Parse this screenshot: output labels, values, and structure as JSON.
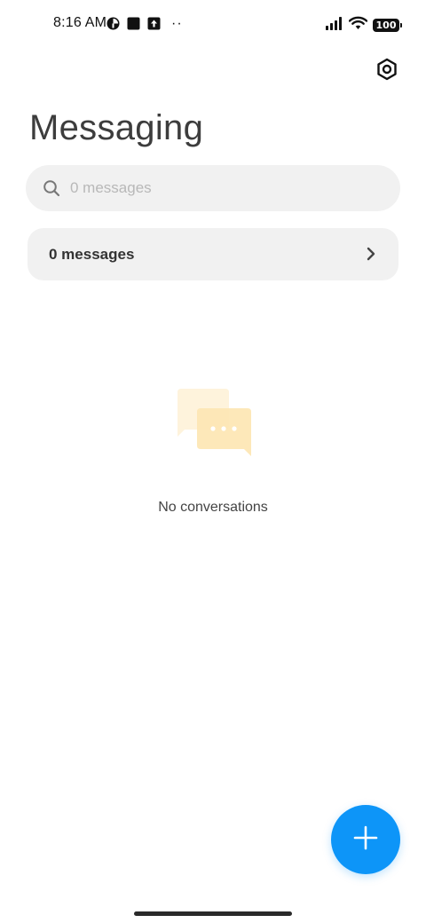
{
  "status_bar": {
    "time": "8:16 AM",
    "left_icons": [
      "app-notification-icon",
      "square-notification-icon",
      "upload-notification-icon"
    ],
    "more_dots": "··",
    "battery": "100",
    "right_icons": [
      "signal-icon",
      "wifi-icon",
      "battery-icon"
    ]
  },
  "header": {
    "title": "Messaging",
    "settings_icon": "settings-icon"
  },
  "search": {
    "placeholder": "0 messages",
    "value": ""
  },
  "messages_row": {
    "label": "0 messages"
  },
  "empty_state": {
    "text": "No conversations",
    "illustration": "chat-bubbles-icon"
  },
  "fab": {
    "icon": "plus-icon"
  },
  "colors": {
    "accent": "#0d95f8",
    "surface": "#f1f1f1",
    "illustration_front": "#fde6b3",
    "illustration_back": "#fef3dc"
  }
}
